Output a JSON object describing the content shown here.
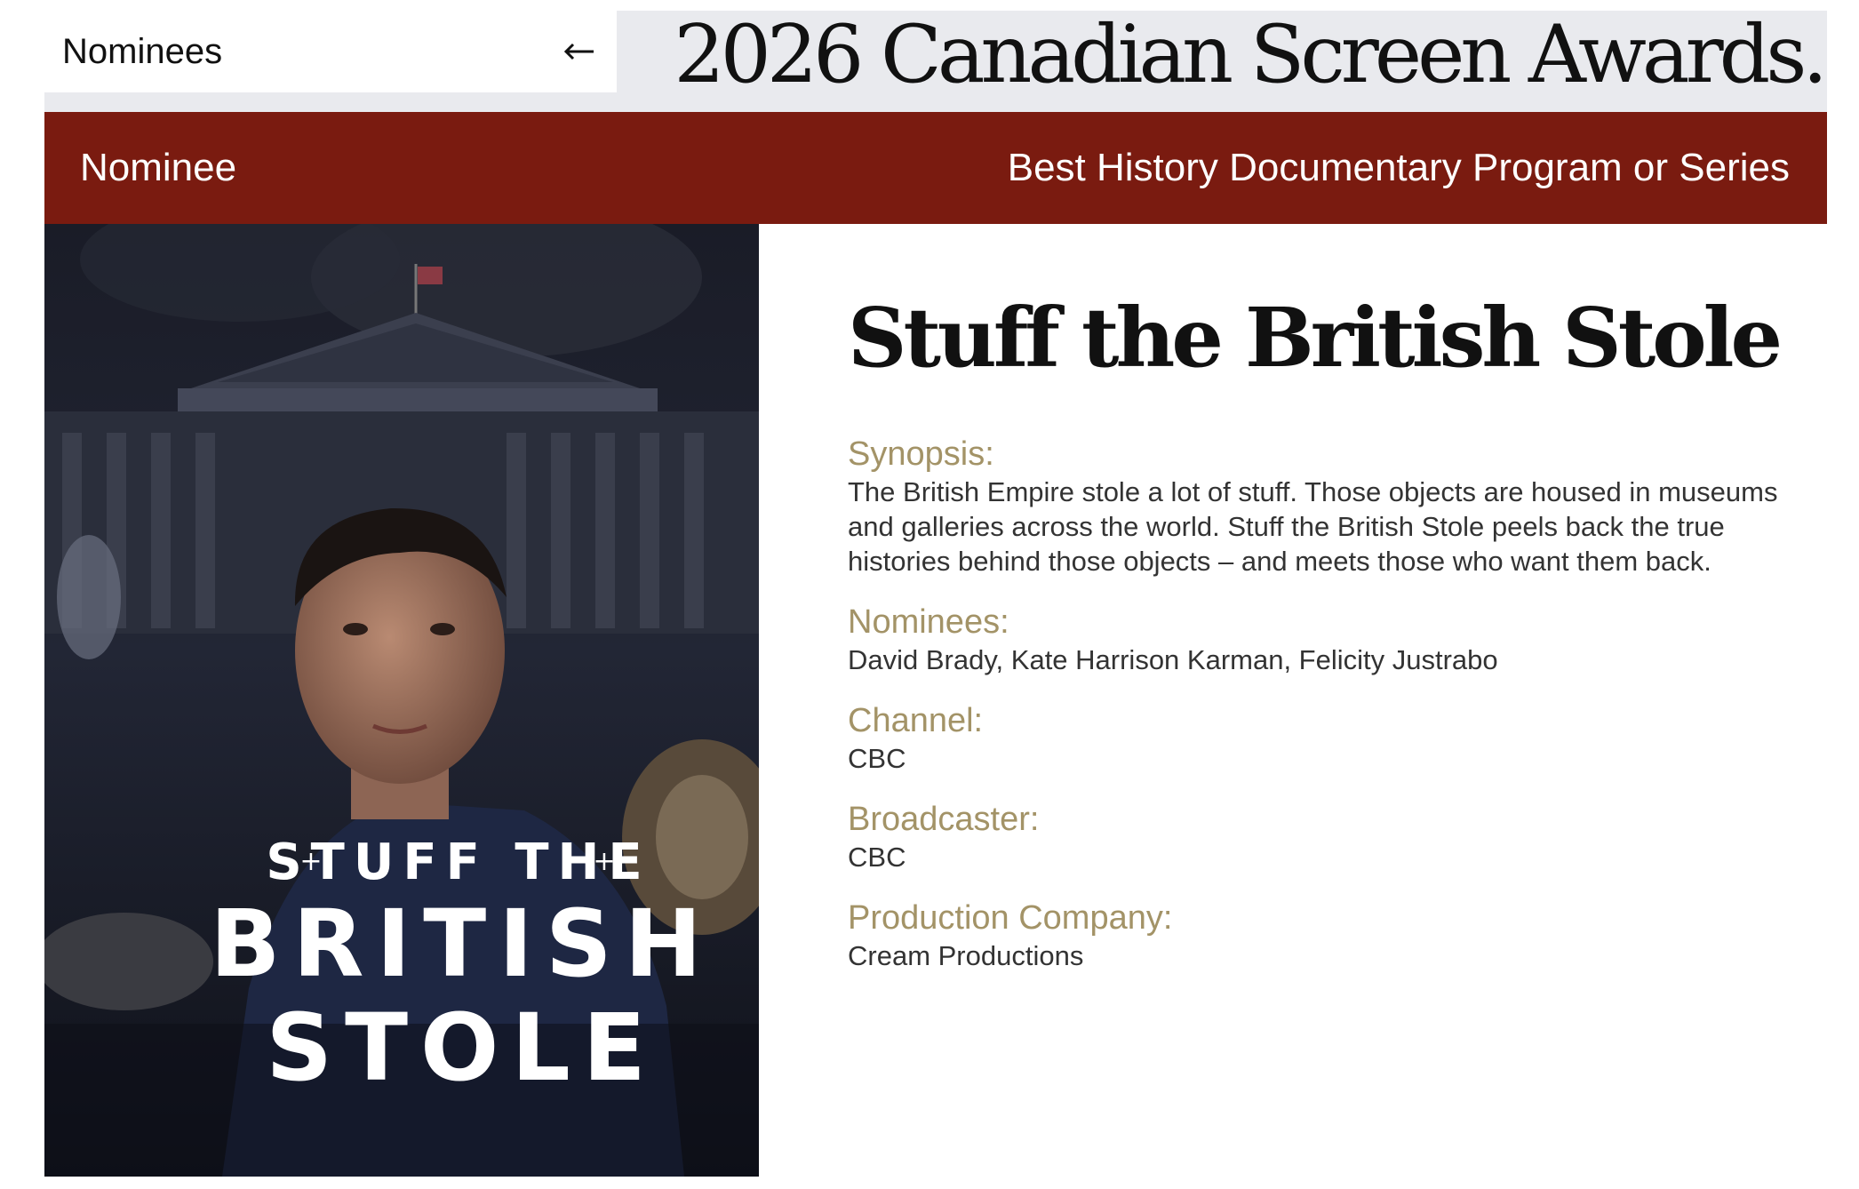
{
  "header": {
    "back_label": "Nominees",
    "site_title": "2026 Canadian Screen Awards."
  },
  "category_bar": {
    "left": "Nominee",
    "right": "Best History Documentary Program or Series"
  },
  "poster": {
    "line1": "STUFF THE",
    "line2": "BRITISH",
    "line3": "STOLE"
  },
  "show": {
    "title": "Stuff the British Stole",
    "synopsis_label": "Synopsis:",
    "synopsis": "The British Empire stole a lot of stuff. Those objects are housed in museums and galleries across the world. Stuff the British Stole peels back the true histories behind those objects – and meets those who want them back.",
    "nominees_label": "Nominees:",
    "nominees": "David Brady, Kate Harrison Karman, Felicity Justrabo",
    "channel_label": "Channel:",
    "channel": "CBC",
    "broadcaster_label": "Broadcaster:",
    "broadcaster": "CBC",
    "production_label": "Production Company:",
    "production": "Cream Productions"
  },
  "colors": {
    "accent_bar": "#7a1b10",
    "label_gold": "#a39367",
    "header_gray": "#e9eaee"
  },
  "icons": {
    "back": "arrow-left-icon"
  }
}
